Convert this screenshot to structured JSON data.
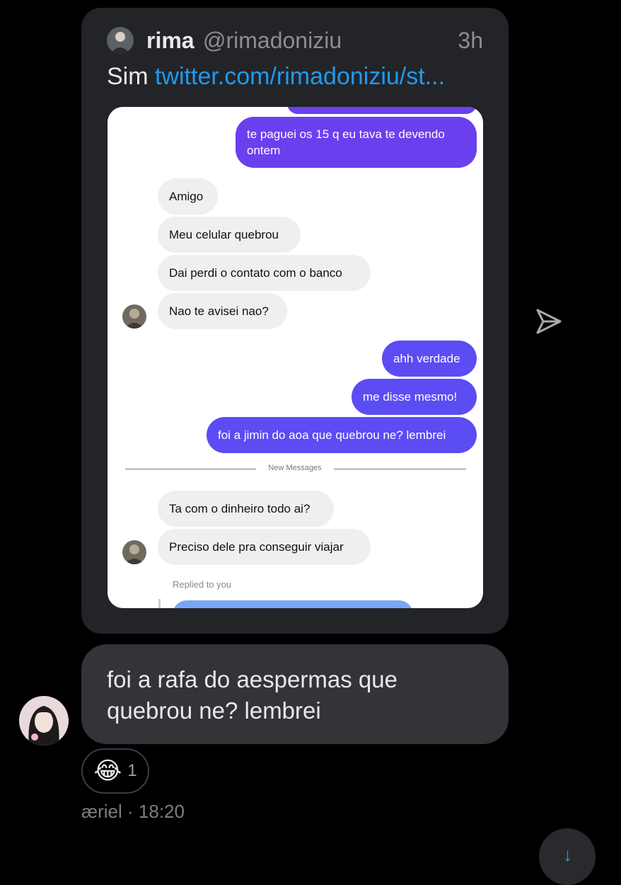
{
  "quoted_tweet": {
    "author_name": "rima",
    "author_handle": "@rimadoniziu",
    "time_ago": "3h",
    "text_prefix": "Sim ",
    "link_text": "twitter.com/rimadoniziu/st...",
    "screenshot": {
      "sent_messages_top": [
        "te paguei os 15 q eu tava te devendo ontem"
      ],
      "received_messages_1": [
        "Amigo",
        "Meu celular quebrou",
        "Dai perdi o contato com o banco",
        "Nao te avisei nao?"
      ],
      "sent_messages_2": [
        "ahh verdade",
        "me disse mesmo!",
        "foi a jimin do aoa que quebrou ne? lembrei"
      ],
      "divider_label": "New Messages",
      "received_messages_2": [
        "Ta com o dinheiro todo ai?",
        "Preciso dele pra conseguir viajar"
      ],
      "replied_label": "Replied to you"
    }
  },
  "message": {
    "text": "foi a rafa do aespermas que quebrou ne? lembrei",
    "reaction_emoji": "😂",
    "reaction_count": "1",
    "sender_meta": "æriel · 18:20"
  },
  "icons": {
    "share": "send-icon",
    "scroll": "scroll-down-icon"
  },
  "colors": {
    "link": "#1d9bf0",
    "sent_bubble": "#5b4cf3",
    "received_bubble": "#efefef",
    "card_bg": "#232428",
    "message_bubble": "#333338"
  }
}
